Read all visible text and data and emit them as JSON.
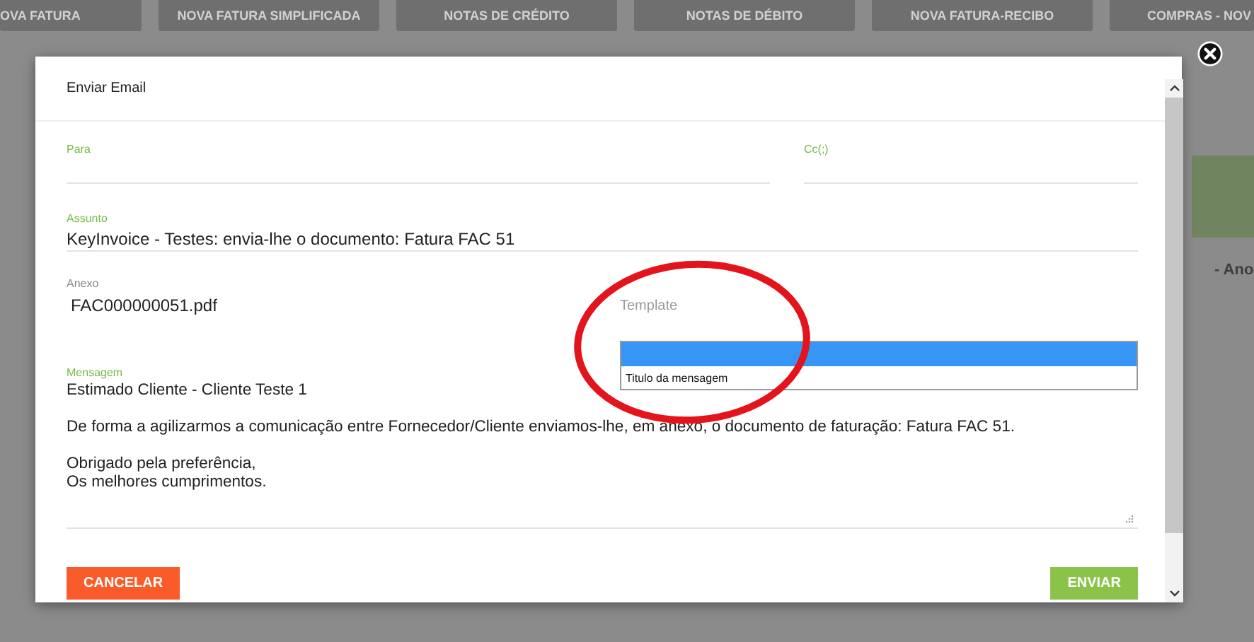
{
  "background_tabs": [
    {
      "label": "OVA FATURA"
    },
    {
      "label": "NOVA FATURA SIMPLIFICADA"
    },
    {
      "label": "NOTAS DE CRÉDITO"
    },
    {
      "label": "NOTAS DE DÉBITO"
    },
    {
      "label": "NOVA FATURA-RECIBO"
    },
    {
      "label": "COMPRAS - NOV"
    }
  ],
  "background_text": "- Ano",
  "dialog": {
    "title": "Enviar Email",
    "to": {
      "label": "Para"
    },
    "cc": {
      "label": "Cc(;)"
    },
    "subject": {
      "label": "Assunto",
      "value": "KeyInvoice - Testes: envia-lhe o documento: Fatura FAC 51"
    },
    "attachment": {
      "label": "Anexo",
      "value": "FAC000000051.pdf"
    },
    "template": {
      "label": "Template",
      "blank_option_highlighted": true,
      "options": [
        {
          "label": "Titulo da mensagem",
          "selected": false
        }
      ]
    },
    "message": {
      "label": "Mensagem",
      "paragraphs": [
        [
          "Estimado Cliente - Cliente Teste 1"
        ],
        [
          "De forma a agilizarmos a comunicação entre Fornecedor/Cliente enviamos-lhe, em anexo, o documento de faturação: Fatura FAC 51."
        ],
        [
          "Obrigado pela preferência,",
          "Os melhores cumprimentos."
        ]
      ]
    },
    "buttons": [
      {
        "label": "CANCELAR",
        "kind": "cancel"
      },
      {
        "label": "ENVIAR",
        "kind": "send"
      }
    ]
  }
}
